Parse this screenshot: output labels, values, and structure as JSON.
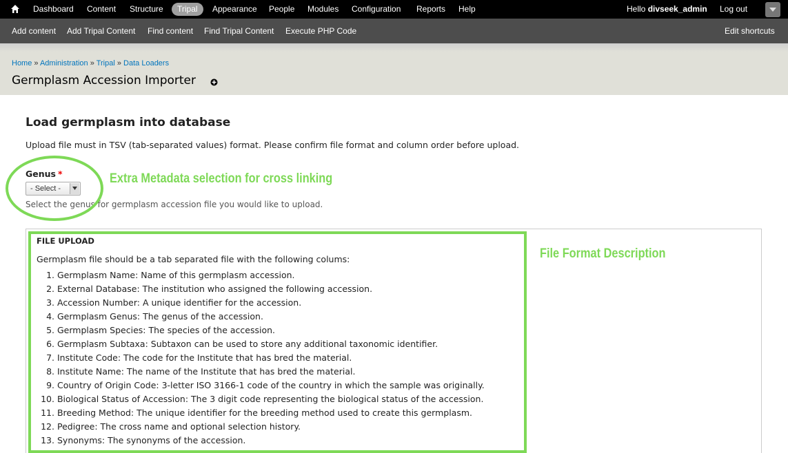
{
  "toolbar": {
    "items": [
      "Dashboard",
      "Content",
      "Structure",
      "Tripal",
      "Appearance",
      "People",
      "Modules",
      "Configuration",
      "Reports",
      "Help"
    ],
    "active": "Tripal",
    "hello_prefix": "Hello ",
    "username": "divseek_admin",
    "logout": "Log out"
  },
  "shortcuts": {
    "items": [
      "Add content",
      "Add Tripal Content",
      "Find content",
      "Find Tripal Content",
      "Execute PHP Code"
    ],
    "edit": "Edit shortcuts"
  },
  "breadcrumb": {
    "items": [
      "Home",
      "Administration",
      "Tripal",
      "Data Loaders"
    ],
    "separator": " » "
  },
  "page": {
    "title": "Germplasm Accession Importer"
  },
  "form": {
    "section_title": "Load germplasm into database",
    "intro": "Upload file must in TSV (tab-separated values) format. Please confirm file format and column order before upload.",
    "genus": {
      "label": "Genus",
      "required_mark": "*",
      "selected": "- Select -",
      "description": "Select the genus for germplasm accession file you would like to upload."
    },
    "file_upload": {
      "title": "FILE UPLOAD",
      "intro": "Germplasm file should be a tab separated file with the following colums:",
      "columns": [
        "Germplasm Name: Name of this germplasm accession.",
        "External Database: The institution who assigned the following accession.",
        "Accession Number: A unique identifier for the accession.",
        "Germplasm Genus: The genus of the accession.",
        "Germplasm Species: The species of the accession.",
        "Germplasm Subtaxa: Subtaxon can be used to store any additional taxonomic identifier.",
        "Institute Code: The code for the Institute that has bred the material.",
        "Institute Name: The name of the Institute that has bred the material.",
        "Country of Origin Code: 3-letter ISO 3166-1 code of the country in which the sample was originally.",
        "Biological Status of Accession: The 3 digit code representing the biological status of the accession.",
        "Breeding Method: The unique identifier for the breeding method used to create this germplasm.",
        "Pedigree: The cross name and optional selection history.",
        "Synonyms: The synonyms of the accession."
      ]
    }
  },
  "annotations": {
    "metadata": "Extra Metadata selection for cross linking",
    "file_format": "File Format Description"
  },
  "colors": {
    "annotation_green": "#7ed957",
    "link_blue": "#0074bd",
    "toolbar_bg": "#000000",
    "shortcuts_bg": "#4d4d4d"
  },
  "icons": {
    "home": "home-icon",
    "title_action": "add-shortcut-icon",
    "toggle": "chevron-down-icon",
    "select_arrow": "chevron-down-icon"
  }
}
